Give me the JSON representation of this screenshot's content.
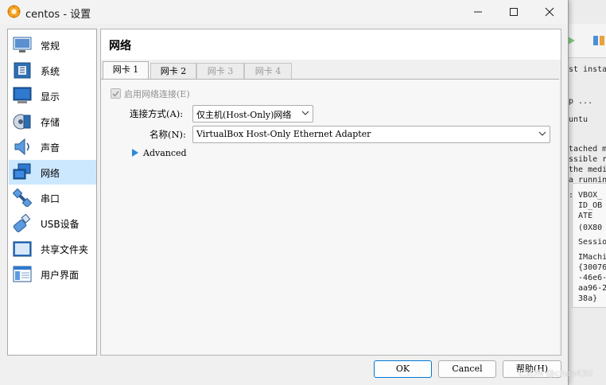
{
  "background_window": {
    "lines": [
      "st insta",
      "p ...",
      "untu",
      "tached m",
      "ssible re",
      "the media",
      "a running",
      ": VBOX_",
      "  ID_OB",
      "  ATE",
      "  (0X80",
      "  Sessio",
      "  IMachi",
      "  {30076",
      "  -46e6-",
      "  aa96-2",
      "  38a}"
    ]
  },
  "window": {
    "title": "centos - 设置",
    "minimize_icon": "minimize-icon",
    "maximize_icon": "maximize-icon",
    "close_icon": "close-icon"
  },
  "sidebar": {
    "items": [
      {
        "label": "常规",
        "icon": "general-icon"
      },
      {
        "label": "系统",
        "icon": "system-icon"
      },
      {
        "label": "显示",
        "icon": "display-icon"
      },
      {
        "label": "存储",
        "icon": "storage-icon"
      },
      {
        "label": "声音",
        "icon": "audio-icon"
      },
      {
        "label": "网络",
        "icon": "network-icon",
        "active": true
      },
      {
        "label": "串口",
        "icon": "serial-port-icon"
      },
      {
        "label": "USB设备",
        "icon": "usb-icon"
      },
      {
        "label": "共享文件夹",
        "icon": "shared-folder-icon"
      },
      {
        "label": "用户界面",
        "icon": "user-interface-icon"
      }
    ]
  },
  "content": {
    "title": "网络",
    "tabs": [
      {
        "label": "网卡 1",
        "state": "active"
      },
      {
        "label": "网卡 2",
        "state": "enabled"
      },
      {
        "label": "网卡 3",
        "state": "disabled"
      },
      {
        "label": "网卡 4",
        "state": "disabled"
      }
    ],
    "enable_checkbox": {
      "label": "启用网络连接(E)",
      "checked": true,
      "disabled": true
    },
    "attached_to": {
      "label": "连接方式(A):",
      "value": "仅主机(Host-Only)网络"
    },
    "name": {
      "label": "名称(N):",
      "value": "VirtualBox Host-Only Ethernet Adapter"
    },
    "advanced": {
      "label": "Advanced"
    }
  },
  "buttons": {
    "ok": "OK",
    "cancel": "Cancel",
    "help": "帮助(H)"
  },
  "watermark": "CSDN @chao430",
  "colors": {
    "selection": "#cce8ff",
    "accent": "#0078d4"
  }
}
